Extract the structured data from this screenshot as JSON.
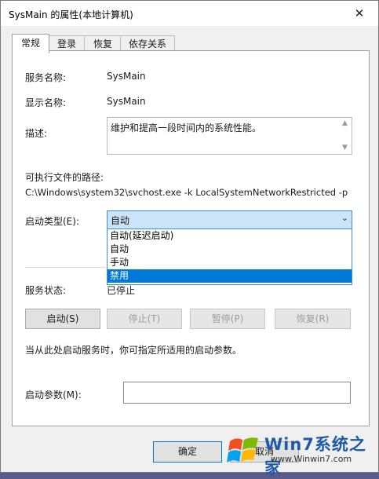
{
  "window": {
    "title": "SysMain 的属性(本地计算机)",
    "close_glyph": "✕"
  },
  "tabs": [
    {
      "label": "常规",
      "active": true
    },
    {
      "label": "登录",
      "active": false
    },
    {
      "label": "恢复",
      "active": false
    },
    {
      "label": "依存关系",
      "active": false
    }
  ],
  "general": {
    "service_name_label": "服务名称:",
    "service_name": "SysMain",
    "display_name_label": "显示名称:",
    "display_name": "SysMain",
    "description_label": "描述:",
    "description": "维护和提高一段时间内的系统性能。",
    "path_label": "可执行文件的路径:",
    "path": "C:\\Windows\\system32\\svchost.exe -k LocalSystemNetworkRestricted -p",
    "startup_type_label": "启动类型(E):",
    "startup_type_value": "自动",
    "startup_options": [
      "自动(延迟启动)",
      "自动",
      "手动",
      "禁用"
    ],
    "startup_highlighted": "禁用",
    "status_label": "服务状态:",
    "status_value": "已停止",
    "hint": "当从此处启动服务时，你可指定所适用的启动参数。",
    "params_label": "启动参数(M):",
    "params_value": ""
  },
  "service_buttons": {
    "start": "启动(S)",
    "stop": "停止(T)",
    "pause": "暂停(P)",
    "resume": "恢复(R)"
  },
  "footer": {
    "ok": "确定",
    "cancel": "取消"
  },
  "watermark": {
    "brand": "Win7系统之家",
    "url": "www.Winwin7.com"
  },
  "colors": {
    "accent": "#0078d7",
    "select_bg": "#cce4f7"
  },
  "icons": {
    "close": "close-icon",
    "dropdown": "chevron-down-icon",
    "scroll_up": "scroll-up-icon",
    "scroll_down": "scroll-down-icon"
  }
}
